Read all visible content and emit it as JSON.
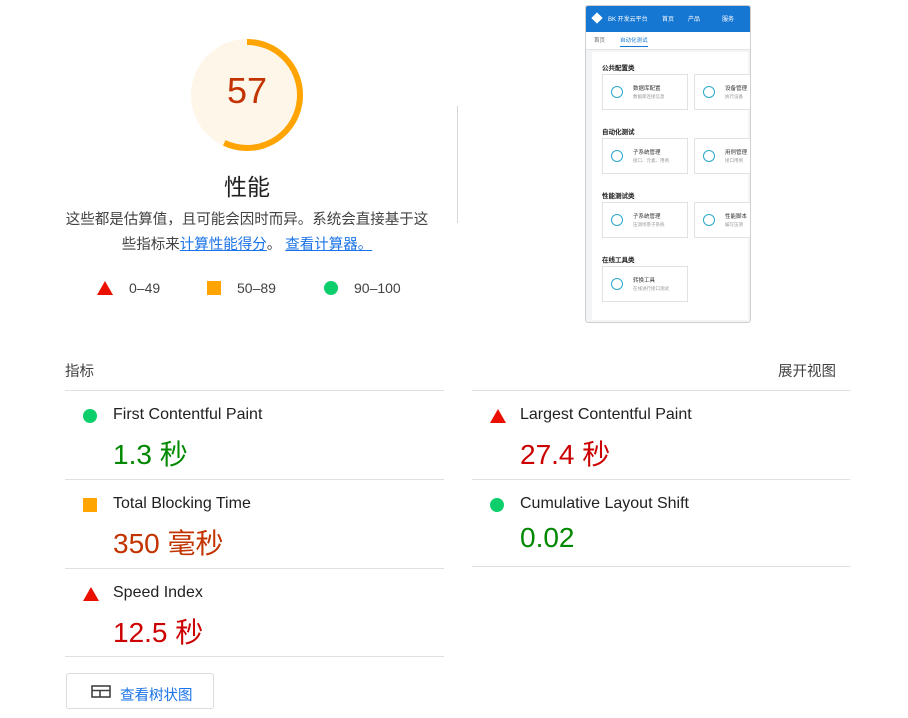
{
  "score": {
    "value": "57",
    "fraction": 0.57,
    "category": "性能",
    "color": "#ffa400",
    "text_color": "#c33300"
  },
  "description": {
    "line1": "这些都是估算值，且可能会因时而异。系统会直接基于这",
    "line2_prefix": "些指标来",
    "link1": "计算性能得分",
    "sep": "。",
    "link2": "查看计算器。"
  },
  "legend": [
    {
      "icon": "triangle-red",
      "label": "0–49"
    },
    {
      "icon": "square-orange",
      "label": "50–89"
    },
    {
      "icon": "circle-green",
      "label": "90–100"
    }
  ],
  "thumbnail": {
    "topbar": {
      "title": "BK 开发云平台",
      "nav1": "首页",
      "nav2": "产品",
      "nav3": "服务"
    },
    "tabs": {
      "tab1": "首页",
      "tab2": "自动化测试"
    },
    "sections": [
      {
        "title": "公共配置类",
        "cards": [
          {
            "t1": "数据库配置",
            "t2": "数据库连接信息"
          },
          {
            "t1": "设备管理",
            "t2": "执行设备"
          }
        ]
      },
      {
        "title": "自动化测试",
        "cards": [
          {
            "t1": "子系统管理",
            "t2": "接口、元素、用例"
          },
          {
            "t1": "用例管理",
            "t2": "接口用例"
          }
        ]
      },
      {
        "title": "性能测试类",
        "cards": [
          {
            "t1": "子系统管理",
            "t2": "压测场景子系统"
          },
          {
            "t1": "性能脚本",
            "t2": "编写压测"
          }
        ]
      },
      {
        "title": "在线工具类",
        "cards": [
          {
            "t1": "转换工具",
            "t2": "在线进行接口测试"
          }
        ]
      }
    ]
  },
  "metrics_header": {
    "title": "指标",
    "expand": "展开视图"
  },
  "metrics": {
    "fcp": {
      "title": "First Contentful Paint",
      "value": "1.3 秒",
      "status": "good"
    },
    "lcp": {
      "title": "Largest Contentful Paint",
      "value": "27.4 秒",
      "status": "poor"
    },
    "tbt": {
      "title": "Total Blocking Time",
      "value": "350 毫秒",
      "status": "average"
    },
    "cls": {
      "title": "Cumulative Layout Shift",
      "value": "0.02",
      "status": "good"
    },
    "si": {
      "title": "Speed Index",
      "value": "12.5 秒",
      "status": "poor"
    }
  },
  "treemap_button": {
    "label": "查看树状图",
    "icon": "treemap-icon"
  },
  "colors": {
    "good": "#0cce6b",
    "average": "#ffa400",
    "poor": "#eb0f00",
    "link": "#1a73e8"
  }
}
